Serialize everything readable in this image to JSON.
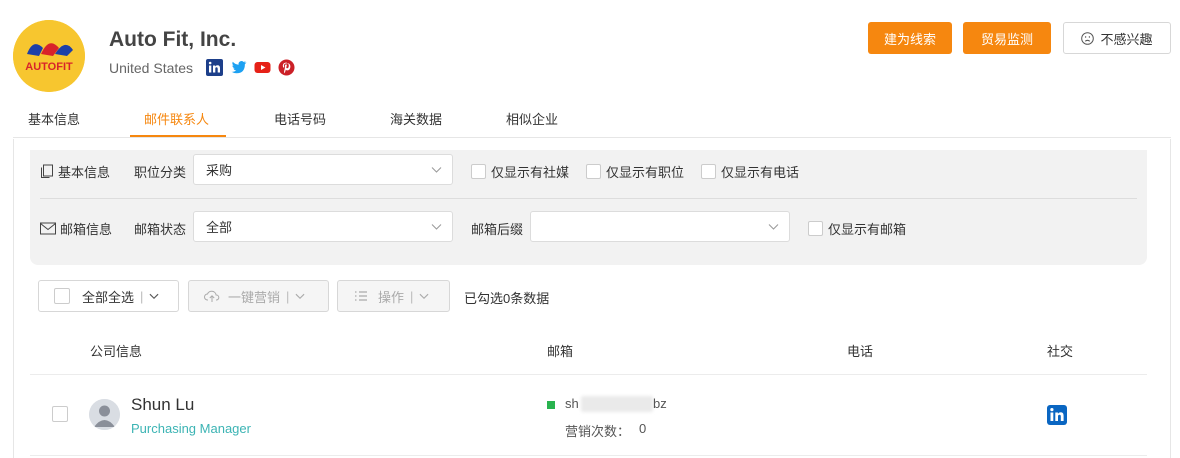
{
  "company": {
    "logo_text": "AUTOFIT",
    "name": "Auto Fit, Inc.",
    "country": "United States",
    "social_icons": [
      "linkedin-icon",
      "twitter-icon",
      "youtube-icon",
      "pinterest-icon"
    ]
  },
  "actions": {
    "create_lead": "建为线索",
    "trade_monitor": "贸易监测",
    "not_interested": "不感兴趣"
  },
  "tabs": [
    {
      "label": "基本信息",
      "active": false
    },
    {
      "label": "邮件联系人",
      "active": true
    },
    {
      "label": "电话号码",
      "active": false
    },
    {
      "label": "海关数据",
      "active": false
    },
    {
      "label": "相似企业",
      "active": false
    }
  ],
  "filters": {
    "basic_section": "基本信息",
    "position_label": "职位分类",
    "position_value": "采购",
    "only_social": "仅显示有社媒",
    "only_position": "仅显示有职位",
    "only_phone": "仅显示有电话",
    "email_section": "邮箱信息",
    "email_status_label": "邮箱状态",
    "email_status_value": "全部",
    "email_suffix_label": "邮箱后缀",
    "email_suffix_value": "",
    "only_email": "仅显示有邮箱"
  },
  "toolbar": {
    "select_all": "全部全选",
    "one_click_marketing": "一键营销",
    "operations": "操作",
    "selected_text": "已勾选0条数据"
  },
  "table": {
    "headers": [
      "公司信息",
      "邮箱",
      "电话",
      "社交"
    ],
    "rows": [
      {
        "name": "Shun Lu",
        "title": "Purchasing Manager",
        "email_prefix": "sh",
        "email_suffix": "bz",
        "marketing_label": "营销次数：",
        "marketing_count": "0"
      }
    ]
  },
  "colors": {
    "accent": "#f6870f",
    "title_teal": "#3cb4b4",
    "email_valid": "#29b34f",
    "linkedin": "#0a66c2"
  }
}
